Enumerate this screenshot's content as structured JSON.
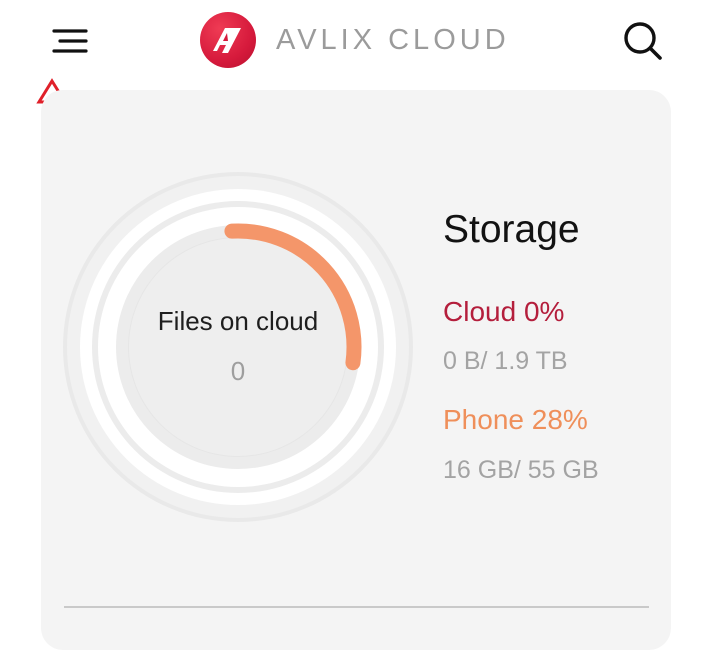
{
  "header": {
    "menu_icon": "hamburger-menu-icon",
    "brand_name": "AVLIX CLOUD",
    "brand_color": "#d61a3c",
    "search_icon": "search-icon"
  },
  "annotation": {
    "arrow_color": "#e0202a",
    "icon": "outline-up-arrow"
  },
  "storage_ring": {
    "label": "Files on cloud",
    "value": "0",
    "cloud_fraction": 0.0,
    "phone_fraction": 0.28,
    "phone_color": "#f4966a"
  },
  "storage": {
    "title": "Storage",
    "cloud_label": "Cloud 0%",
    "cloud_color": "#b41e3c",
    "cloud_usage": "0 B/ 1.9 TB",
    "phone_label": "Phone 28%",
    "phone_color": "#ef8f5a",
    "phone_usage": "16 GB/ 55 GB"
  }
}
